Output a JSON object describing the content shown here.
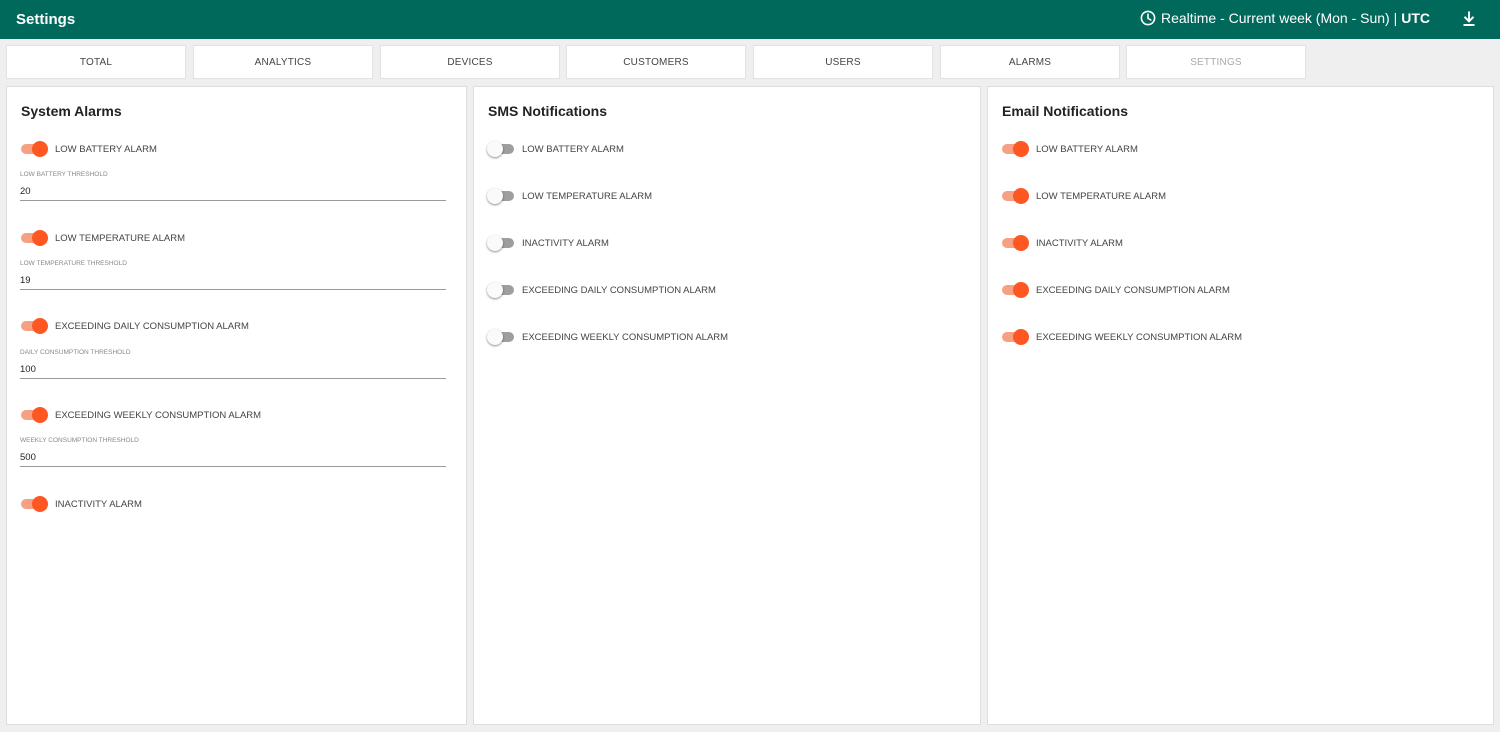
{
  "header": {
    "title": "Settings",
    "time_range": "Realtime - Current week (Mon - Sun) |",
    "timezone": "UTC"
  },
  "tabs": [
    {
      "label": "TOTAL",
      "disabled": false
    },
    {
      "label": "ANALYTICS",
      "disabled": false
    },
    {
      "label": "DEVICES",
      "disabled": false
    },
    {
      "label": "CUSTOMERS",
      "disabled": false
    },
    {
      "label": "USERS",
      "disabled": false
    },
    {
      "label": "ALARMS",
      "disabled": false
    },
    {
      "label": "SETTINGS",
      "disabled": true
    }
  ],
  "colors": {
    "header_bg": "#00695c",
    "toggle_on": "#ff5722",
    "toggle_off": "#9e9e9e"
  },
  "system_alarms": {
    "title": "System Alarms",
    "items": [
      {
        "label": "LOW BATTERY ALARM",
        "enabled": true,
        "threshold_label": "LOW BATTERY THRESHOLD",
        "threshold_value": "20"
      },
      {
        "label": "LOW TEMPERATURE ALARM",
        "enabled": true,
        "threshold_label": "LOW TEMPERATURE THRESHOLD",
        "threshold_value": "19"
      },
      {
        "label": "EXCEEDING DAILY CONSUMPTION ALARM",
        "enabled": true,
        "threshold_label": "DAILY CONSUMPTION THRESHOLD",
        "threshold_value": "100"
      },
      {
        "label": "EXCEEDING WEEKLY CONSUMPTION ALARM",
        "enabled": true,
        "threshold_label": "WEEKLY CONSUMPTION THRESHOLD",
        "threshold_value": "500"
      },
      {
        "label": "INACTIVITY ALARM",
        "enabled": true
      }
    ]
  },
  "sms_notifications": {
    "title": "SMS Notifications",
    "items": [
      {
        "label": "LOW BATTERY ALARM",
        "enabled": false
      },
      {
        "label": "LOW TEMPERATURE ALARM",
        "enabled": false
      },
      {
        "label": "INACTIVITY ALARM",
        "enabled": false
      },
      {
        "label": "EXCEEDING DAILY CONSUMPTION ALARM",
        "enabled": false
      },
      {
        "label": "EXCEEDING WEEKLY CONSUMPTION ALARM",
        "enabled": false
      }
    ]
  },
  "email_notifications": {
    "title": "Email Notifications",
    "items": [
      {
        "label": "LOW BATTERY ALARM",
        "enabled": true
      },
      {
        "label": "LOW TEMPERATURE ALARM",
        "enabled": true
      },
      {
        "label": "INACTIVITY ALARM",
        "enabled": true
      },
      {
        "label": "EXCEEDING DAILY CONSUMPTION ALARM",
        "enabled": true
      },
      {
        "label": "EXCEEDING WEEKLY CONSUMPTION ALARM",
        "enabled": true
      }
    ]
  }
}
